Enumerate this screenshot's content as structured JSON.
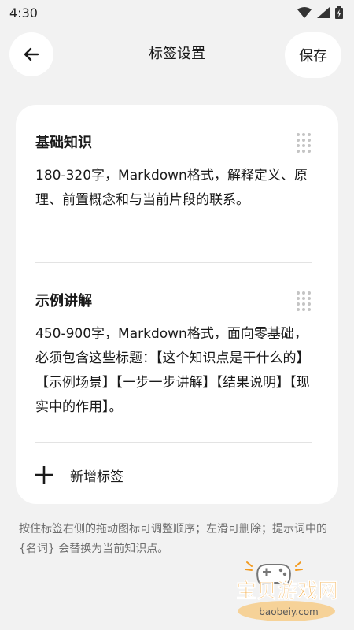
{
  "status_bar": {
    "time": "4:30"
  },
  "header": {
    "title": "标签设置",
    "save_label": "保存"
  },
  "tags": [
    {
      "name": "基础知识",
      "description": "180-320字，Markdown格式，解释定义、原理、前置概念和与当前片段的联系。"
    },
    {
      "name": "示例讲解",
      "description": "450-900字，Markdown格式，面向零基础，必须包含这些标题：【这个知识点是干什么的】【示例场景】【一步一步讲解】【结果说明】【现实中的作用】。"
    }
  ],
  "add_tag": {
    "label": "新增标签"
  },
  "hint": "按住标签右侧的拖动图标可调整顺序；左滑可删除；提示词中的 {名词} 会替换为当前知识点。",
  "watermark": {
    "brand": "宝贝游戏网",
    "url": "baobeiy.com"
  },
  "colors": {
    "background": "#f2f2f2",
    "card": "#ffffff",
    "text": "#1a1a1a",
    "hint": "#6e6e6e",
    "watermark_orange": "#f29a1f"
  }
}
